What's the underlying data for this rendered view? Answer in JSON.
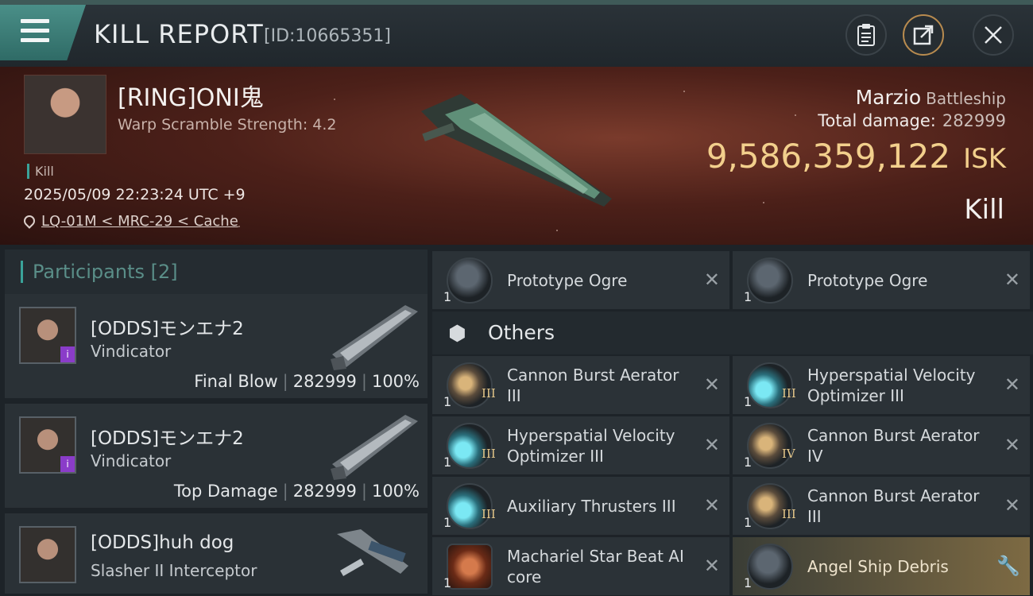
{
  "header": {
    "title": "KILL REPORT",
    "kill_id": "[ID:10665351]",
    "copy_icon": "clipboard-icon",
    "share_icon": "share-icon",
    "close_icon": "close-icon"
  },
  "victim": {
    "name": "[RING]ONI鬼",
    "scramble": "Warp Scramble Strength: 4.2",
    "tag": "Kill",
    "time": "2025/05/09 22:23:24 UTC +9",
    "location": "LQ-01M < MRC-29 < Cache",
    "ship_name": "Marzio",
    "ship_class": "Battleship",
    "total_damage_label": "Total damage:",
    "total_damage": "282999",
    "isk_value": "9,586,359,122",
    "isk_unit": "ISK",
    "outcome": "Kill"
  },
  "participants": {
    "label": "Participants",
    "count": "[2]",
    "rows": [
      {
        "name": "[ODDS]モンエナ2",
        "ship": "Vindicator",
        "role": "Final Blow",
        "damage": "282999",
        "pct": "100%",
        "badge": "i"
      },
      {
        "name": "[ODDS]モンエナ2",
        "ship": "Vindicator",
        "role": "Top Damage",
        "damage": "282999",
        "pct": "100%",
        "badge": "i"
      },
      {
        "name": "[ODDS]huh dog",
        "ship": "Slasher II Interceptor"
      }
    ]
  },
  "items": {
    "top": [
      {
        "name": "Prototype  Ogre",
        "qty": "1"
      },
      {
        "name": "Prototype  Ogre",
        "qty": "1"
      }
    ],
    "others_label": "Others",
    "others": [
      {
        "name": "Cannon Burst Aerator III",
        "qty": "1",
        "tier": "III"
      },
      {
        "name": "Hyperspatial Velocity Optimizer III",
        "qty": "1",
        "tier": "III"
      },
      {
        "name": "Hyperspatial Velocity Optimizer III",
        "qty": "1",
        "tier": "III"
      },
      {
        "name": "Cannon Burst Aerator IV",
        "qty": "1",
        "tier": "IV"
      },
      {
        "name": "Auxiliary Thrusters III",
        "qty": "1",
        "tier": "III"
      },
      {
        "name": "Cannon Burst Aerator III",
        "qty": "1",
        "tier": "III"
      },
      {
        "name": "Machariel Star Beat AI core",
        "qty": "1"
      },
      {
        "name": "Angel Ship Debris",
        "qty": "1"
      }
    ],
    "close_glyph": "✕",
    "wrench_glyph": "🔧"
  }
}
